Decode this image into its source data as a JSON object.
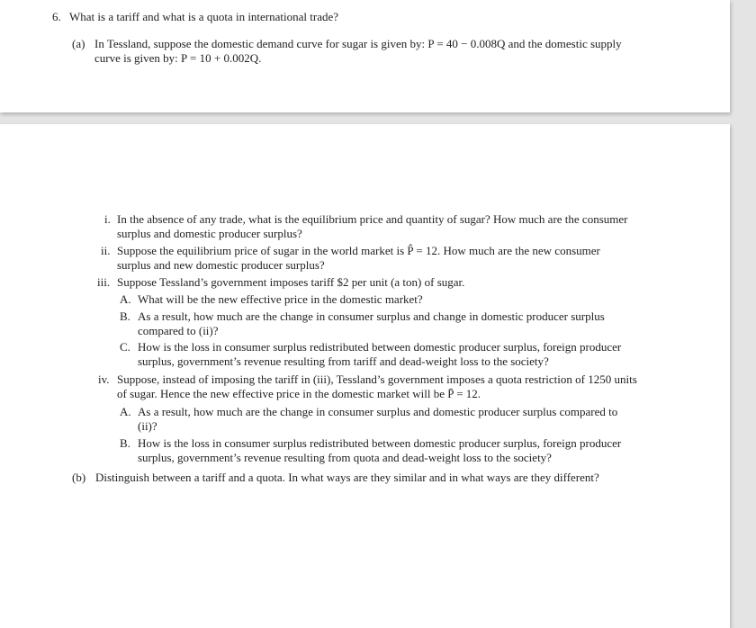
{
  "question": {
    "number": "6.",
    "text": "What is a tariff and what is a quota in international trade?",
    "part_a": {
      "label": "(a)",
      "line1": "In Tessland, suppose the domestic demand curve for sugar is given by: P = 40 − 0.008Q and the domestic supply",
      "line2": "curve is given by: P = 10 + 0.002Q."
    },
    "items": [
      {
        "label": "i.",
        "line1": "In the absence of any trade, what is the equilibrium price and quantity of sugar? How much are the consumer",
        "line2": "surplus and domestic producer surplus?"
      },
      {
        "label": "ii.",
        "line1": "Suppose the equilibrium price of sugar in the world market is P̂ = 12. How much are the new consumer",
        "line2": "surplus and new domestic producer surplus?"
      },
      {
        "label": "iii.",
        "line1": "Suppose Tessland’s government imposes tariff $2 per unit (a ton) of sugar."
      },
      {
        "label": "A.",
        "line1": "What will be the new effective price in the domestic market?"
      },
      {
        "label": "B.",
        "line1": "As a result, how much are the change in consumer surplus and change in domestic producer surplus",
        "line2": "compared to (ii)?"
      },
      {
        "label": "C.",
        "line1": "How is the loss in consumer surplus redistributed between domestic producer surplus, foreign producer",
        "line2": "surplus, government’s revenue resulting from tariff and dead-weight loss to the society?"
      },
      {
        "label": "iv.",
        "line1": "Suppose, instead of imposing the tariff in (iii), Tessland’s government imposes a quota restriction of 1250 units",
        "line2": "of sugar. Hence the new effective price in the domestic market will be P̄ = 12."
      },
      {
        "label": "A.",
        "line1": "As a result, how much are the change in consumer surplus and domestic producer surplus compared to",
        "line2": "(ii)?"
      },
      {
        "label": "B.",
        "line1": "How is the loss in consumer surplus redistributed between domestic producer surplus, foreign producer",
        "line2": "surplus, government’s revenue resulting from quota and dead-weight loss to the society?"
      }
    ],
    "part_b": {
      "label": "(b)",
      "text": "Distinguish between a tariff and a quota. In what ways are they similar and in what ways are they different?"
    }
  }
}
